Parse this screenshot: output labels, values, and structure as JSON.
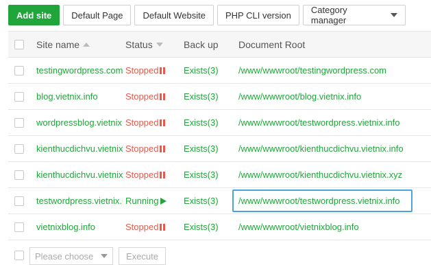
{
  "toolbar": {
    "add_site": "Add site",
    "default_page": "Default Page",
    "default_website": "Default Website",
    "php_cli_version": "PHP CLI version",
    "category_manager": "Category manager"
  },
  "table": {
    "headers": {
      "site_name": "Site name",
      "status": "Status",
      "back_up": "Back up",
      "document_root": "Document Root"
    },
    "rows": [
      {
        "name": "testingwordpress.com",
        "status": "Stopped",
        "backup": "Exists(3)",
        "root": "/www/wwwroot/testingwordpress.com"
      },
      {
        "name": "blog.vietnix.info",
        "status": "Stopped",
        "backup": "Exists(3)",
        "root": "/www/wwwroot/blog.vietnix.info"
      },
      {
        "name": "wordpressblog.vietnix.info",
        "status": "Stopped",
        "backup": "Exists(3)",
        "root": "/www/wwwroot/testwordpress.vietnix.info"
      },
      {
        "name": "kienthucdichvu.vietnix.info",
        "status": "Stopped",
        "backup": "Exists(3)",
        "root": "/www/wwwroot/kienthucdichvu.vietnix.info"
      },
      {
        "name": "kienthucdichvu.vietnix.xyz",
        "status": "Stopped",
        "backup": "Exists(3)",
        "root": "/www/wwwroot/kienthucdichvu.vietnix.xyz"
      },
      {
        "name": "testwordpress.vietnix.info",
        "status": "Running",
        "backup": "Exists(3)",
        "root": "/www/wwwroot/testwordpress.vietnix.info"
      },
      {
        "name": "vietnixblog.info",
        "status": "Stopped",
        "backup": "Exists(3)",
        "root": "/www/wwwroot/vietnixblog.info"
      }
    ]
  },
  "footer": {
    "batch_select_placeholder": "Please choose",
    "execute": "Execute"
  },
  "colors": {
    "accent": "#20a53a",
    "stopped": "#e55a4c",
    "focus_border": "#4aa3df"
  }
}
